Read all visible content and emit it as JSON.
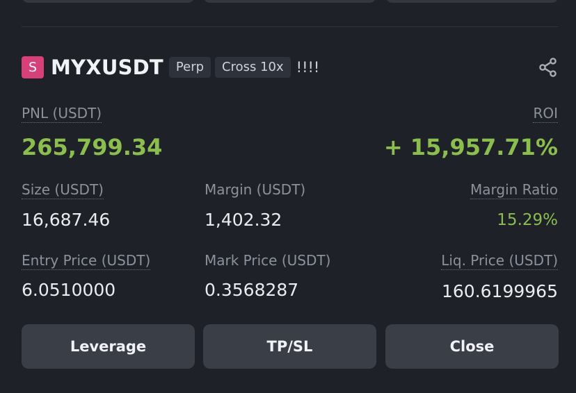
{
  "position": {
    "badge_letter": "S",
    "symbol": "MYXUSDT",
    "tags": [
      "Perp",
      "Cross 10x"
    ],
    "warning_marks": "!!!!",
    "pnl_label": "PNL (USDT)",
    "pnl_value": "265,799.34",
    "roi_label": "ROI",
    "roi_value": "+ 15,957.71%",
    "size_label": "Size (USDT)",
    "size_value": "16,687.46",
    "margin_label": "Margin (USDT)",
    "margin_value": "1,402.32",
    "margin_ratio_label": "Margin Ratio",
    "margin_ratio_value": "15.29%",
    "entry_price_label": "Entry Price (USDT)",
    "entry_price_value": "6.0510000",
    "mark_price_label": "Mark Price (USDT)",
    "mark_price_value": "0.3568287",
    "liq_price_label": "Liq. Price (USDT)",
    "liq_price_value": "160.6199965"
  },
  "actions": {
    "leverage_label": "Leverage",
    "tpsl_label": "TP/SL",
    "close_label": "Close"
  },
  "colors": {
    "background": "#1e2127",
    "positive": "#8bbd4f",
    "badge": "#d8407a",
    "button": "#3a3e47"
  },
  "icons": {
    "share": "share-icon"
  }
}
